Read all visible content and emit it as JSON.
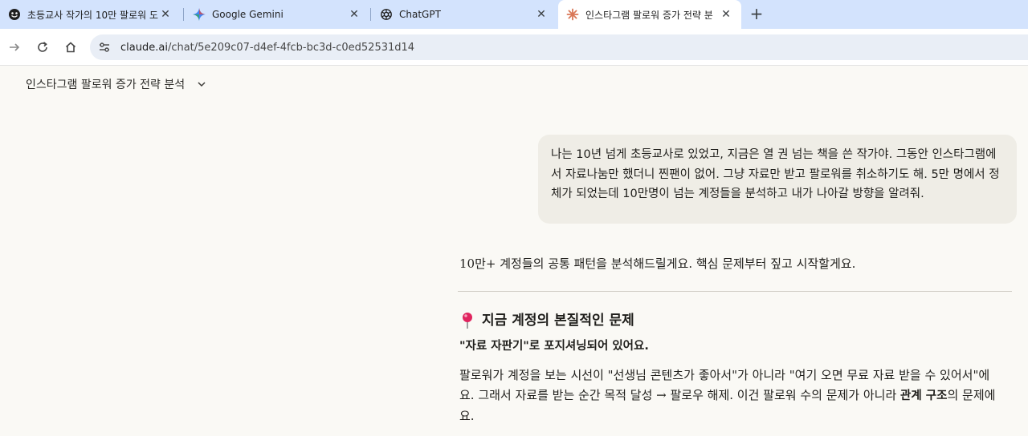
{
  "browser": {
    "tabs": [
      {
        "title": "초등교사 작가의 10만 팔로워 도",
        "favicon": "smiley-face-icon",
        "active": false
      },
      {
        "title": "Google Gemini",
        "favicon": "gemini-sparkle-icon",
        "active": false
      },
      {
        "title": "ChatGPT",
        "favicon": "openai-logo-icon",
        "active": false
      },
      {
        "title": "인스타그램 팔로워 증가 전략 분",
        "favicon": "claude-asterisk-icon",
        "active": true
      }
    ],
    "new_tab_label": "+",
    "url_host": "claude.ai",
    "url_path": "/chat/5e209c07-d4ef-4fcb-bc3d-c0ed52531d14"
  },
  "chat": {
    "title": "인스타그램 팔로워 증가 전략 분석",
    "user_message": "나는 10년 넘게 초등교사로 있었고, 지금은 열 권 넘는 책을 쓴 작가야. 그동안 인스타그램에서 자료나눔만 했더니 찐팬이 없어. 그냥 자료만 받고 팔로워를 취소하기도 해. 5만 명에서 정체가 되었는데 10만명이 넘는 계정들을 분석하고 내가 나아갈 방향을 알려줘.",
    "assistant": {
      "intro": "10만+ 계정들의 공통 패턴을 분석해드릴게요. 핵심 문제부터 짚고 시작할게요.",
      "section_title": "지금 계정의 본질적인 문제",
      "bold_line": "\"자료 자판기\"로 포지셔닝되어 있어요.",
      "para_part1": "팔로워가 계정을 보는 시선이 \"선생님 콘텐츠가 좋아서\"가 아니라 \"여기 오면 무료 자료 받을 수 있어서\"에요. 그래서 자료를 받는 순간 목적 달성 → 팔로우 해제. 이건 팔로워 수의 문제가 아니라 ",
      "para_bold": "관계 구조",
      "para_part2": "의 문제에요."
    }
  }
}
